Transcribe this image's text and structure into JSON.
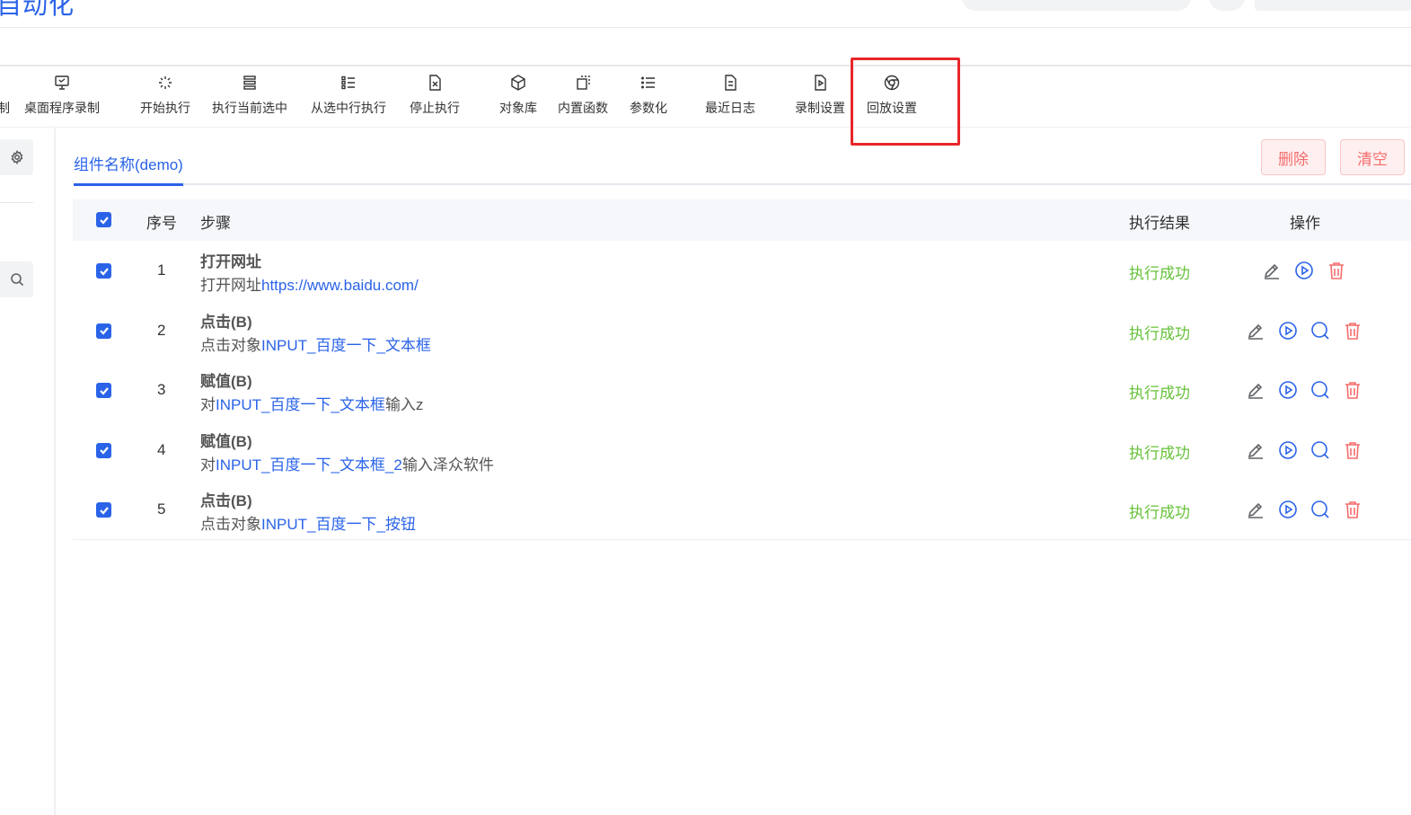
{
  "header": {
    "app_title": "自动化"
  },
  "toolbar": {
    "items": [
      {
        "label": "制"
      },
      {
        "label": "桌面程序录制"
      },
      {
        "label": "开始执行"
      },
      {
        "label": "执行当前选中"
      },
      {
        "label": "从选中行执行"
      },
      {
        "label": "停止执行"
      },
      {
        "label": "对象库"
      },
      {
        "label": "内置函数"
      },
      {
        "label": "参数化"
      },
      {
        "label": "最近日志"
      },
      {
        "label": "录制设置"
      },
      {
        "label": "回放设置"
      }
    ]
  },
  "tabs": {
    "active_label": "组件名称(demo)"
  },
  "actions": {
    "delete_label": "删除",
    "clear_label": "清空"
  },
  "table": {
    "headers": {
      "index": "序号",
      "step": "步骤",
      "result": "执行结果",
      "ops": "操作"
    },
    "rows": [
      {
        "index": "1",
        "title": "打开网址",
        "desc_prefix": "打开网址",
        "desc_obj": "https://www.baidu.com/",
        "desc_suffix": "",
        "result": "执行成功"
      },
      {
        "index": "2",
        "title": "点击(B)",
        "desc_prefix": "点击对象",
        "desc_obj": "INPUT_百度一下_文本框",
        "desc_suffix": "",
        "result": "执行成功"
      },
      {
        "index": "3",
        "title": "赋值(B)",
        "desc_prefix": "对",
        "desc_obj": "INPUT_百度一下_文本框",
        "desc_suffix": "输入z",
        "result": "执行成功"
      },
      {
        "index": "4",
        "title": "赋值(B)",
        "desc_prefix": "对",
        "desc_obj": "INPUT_百度一下_文本框_2",
        "desc_suffix": "输入泽众软件",
        "result": "执行成功"
      },
      {
        "index": "5",
        "title": "点击(B)",
        "desc_prefix": "点击对象",
        "desc_obj": "INPUT_百度一下_按钮",
        "desc_suffix": "",
        "result": "执行成功"
      }
    ]
  },
  "colors": {
    "primary": "#2a63e8",
    "success": "#67c23a",
    "danger": "#f56c6c",
    "highlight": "#e8262a"
  }
}
